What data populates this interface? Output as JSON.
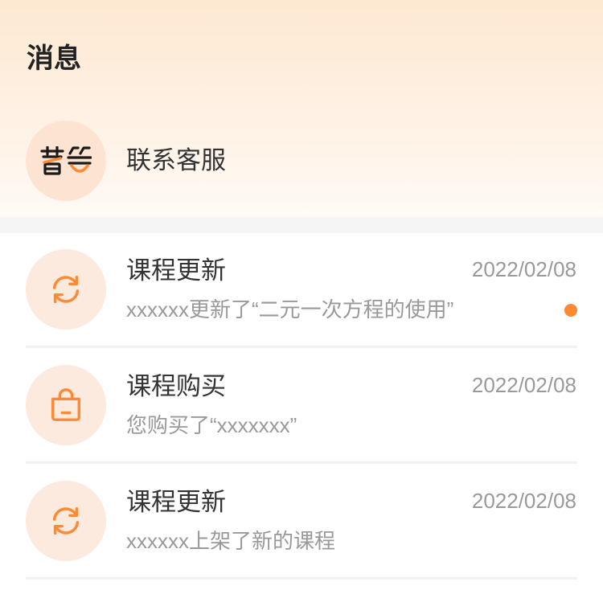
{
  "header": {
    "title": "消息"
  },
  "service": {
    "label": "联系客服",
    "icon": "brand-logo"
  },
  "messages": [
    {
      "icon": "refresh-icon",
      "title": "课程更新",
      "date": "2022/02/08",
      "summary": "xxxxxx更新了“二元一次方程的使用”",
      "unread": true
    },
    {
      "icon": "shopping-bag-icon",
      "title": "课程购买",
      "date": "2022/02/08",
      "summary": "您购买了“xxxxxxx”",
      "unread": false
    },
    {
      "icon": "refresh-icon",
      "title": "课程更新",
      "date": "2022/02/08",
      "summary": "xxxxxx上架了新的课程",
      "unread": false
    }
  ],
  "colors": {
    "accent": "#ff8a33",
    "icon_bg": "#fdeadf",
    "avatar_bg": "#fde4d2",
    "title_text": "#333333",
    "secondary_text": "#999999",
    "header_top": "#fde8d2",
    "header_bottom": "#fffaf5",
    "band": "#f5f5f5",
    "divider": "#f2f2f2"
  }
}
